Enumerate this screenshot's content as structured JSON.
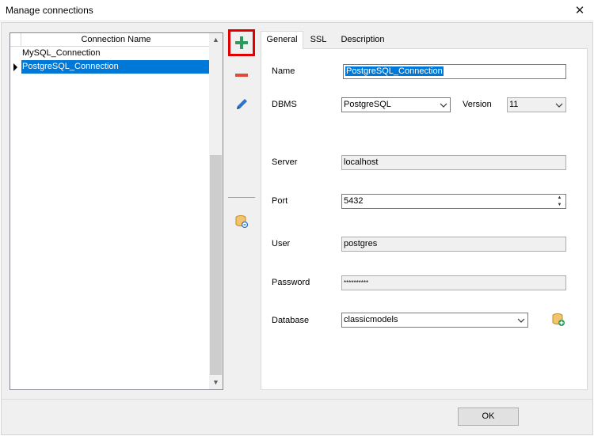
{
  "window": {
    "title": "Manage connections",
    "close_glyph": "✕"
  },
  "grid": {
    "column_header": "Connection Name",
    "rows": [
      {
        "name": "MySQL_Connection",
        "selected": false
      },
      {
        "name": "PostgreSQL_Connection",
        "selected": true
      }
    ]
  },
  "toolbar": {
    "icons": [
      "add-icon",
      "remove-icon",
      "edit-icon",
      "link-database-icon"
    ],
    "colors": {
      "add": "#2e9a5c",
      "remove": "#e04a3a",
      "edit": "#2e73c8",
      "highlight": "#e00000"
    }
  },
  "tabs": [
    {
      "label": "General",
      "active": true
    },
    {
      "label": "SSL",
      "active": false
    },
    {
      "label": "Description",
      "active": false
    }
  ],
  "form": {
    "name_label": "Name",
    "name_value": "PostgreSQL_Connection",
    "dbms_label": "DBMS",
    "dbms_value": "PostgreSQL",
    "version_label": "Version",
    "version_value": "11",
    "server_label": "Server",
    "server_value": "localhost",
    "port_label": "Port",
    "port_value": "5432",
    "user_label": "User",
    "user_value": "postgres",
    "password_label": "Password",
    "password_value": "**********",
    "database_label": "Database",
    "database_value": "classicmodels"
  },
  "footer": {
    "ok_label": "OK"
  }
}
